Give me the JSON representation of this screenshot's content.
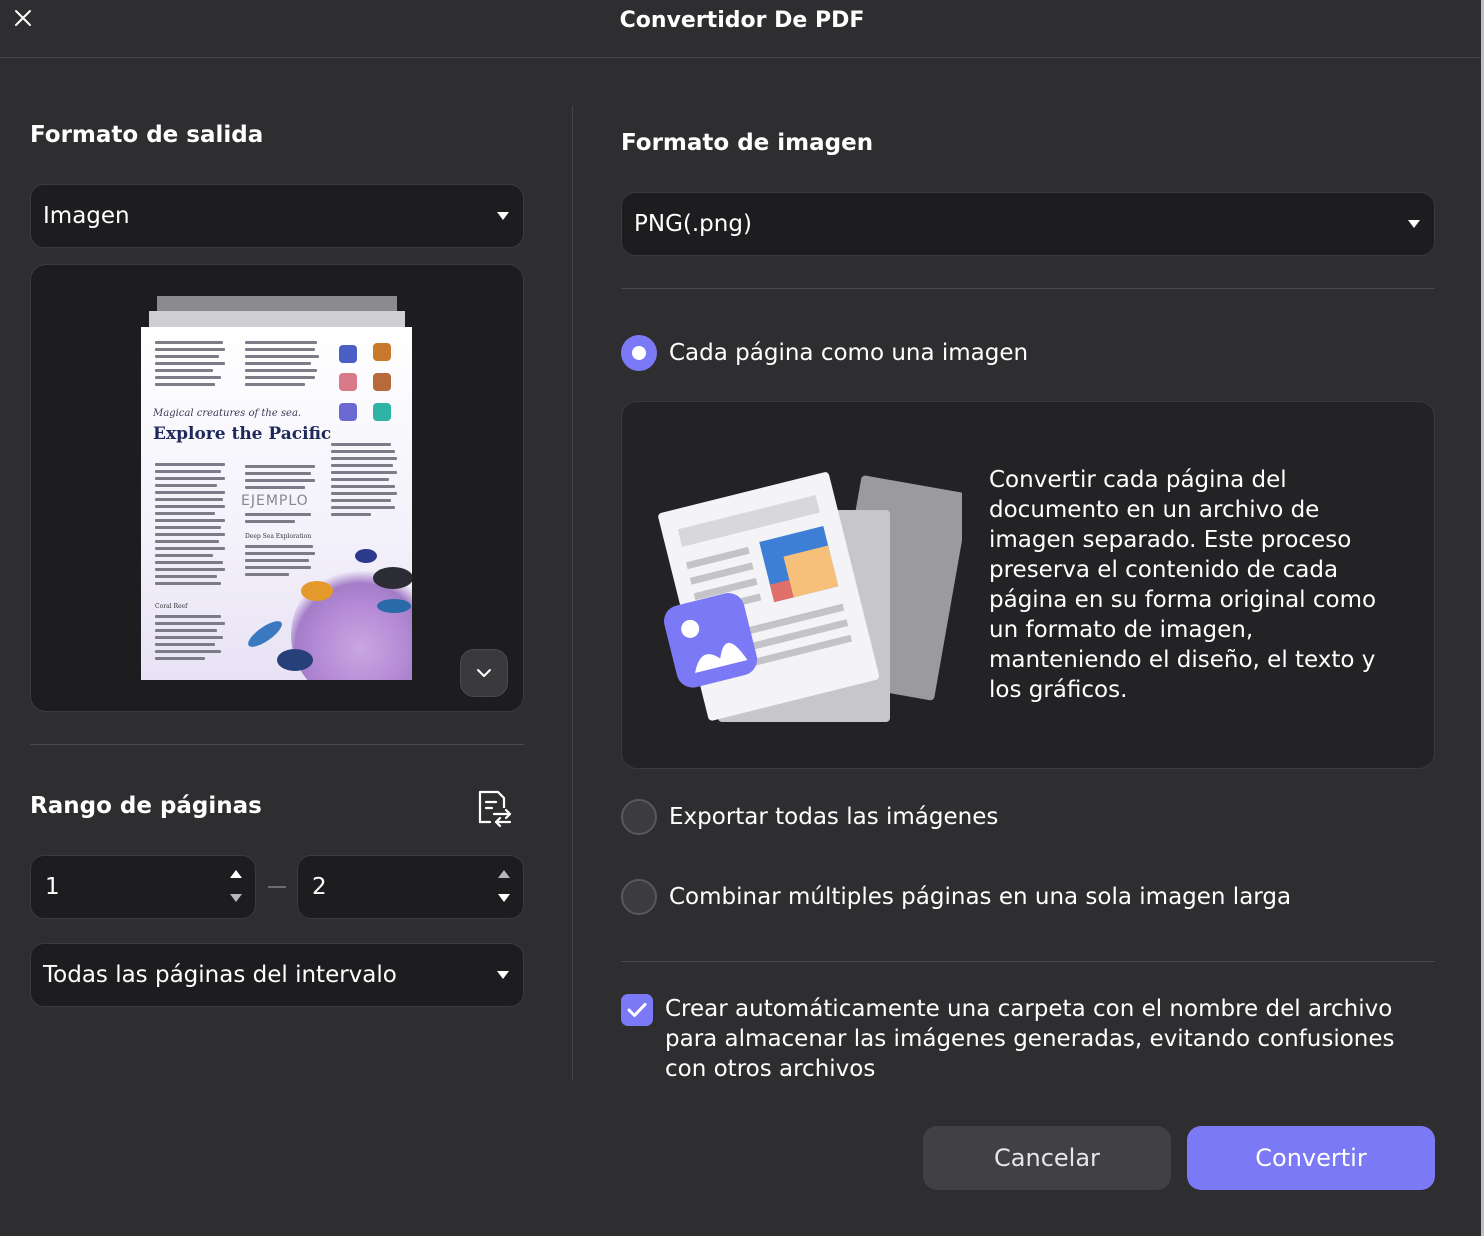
{
  "window": {
    "title": "Convertidor De PDF"
  },
  "output_format": {
    "title": "Formato de salida",
    "selected": "Imagen"
  },
  "preview": {
    "page_subtitle": "Magical creatures of the sea.",
    "page_heading": "Explore the Pacific",
    "watermark": "EJEMPLO",
    "section_a": "Deep Sea Exploration",
    "section_b": "Coral Reef"
  },
  "page_range": {
    "title": "Rango de páginas",
    "from": "1",
    "to": "2",
    "mode": "Todas las páginas del intervalo"
  },
  "image_format": {
    "title": "Formato de imagen",
    "selected": "PNG(.png)"
  },
  "options": {
    "each_page": "Cada página como una imagen",
    "export_all": "Exportar todas las imágenes",
    "combine": "Combinar múltiples páginas en una sola imagen larga",
    "selected": "each_page"
  },
  "info": {
    "description": "Convertir cada página del documento en un archivo de imagen separado. Este proceso preserva el contenido de cada página en su forma original como un formato de imagen, manteniendo el diseño, el texto y los gráficos."
  },
  "auto_folder": {
    "checked": true,
    "label": "Crear automáticamente una carpeta con el nombre del archivo para almacenar las imágenes generadas, evitando confusiones con otros archivos"
  },
  "buttons": {
    "cancel": "Cancelar",
    "convert": "Convertir"
  },
  "colors": {
    "accent": "#7b79f5",
    "background": "#2e2e30",
    "field": "#1d1d1f"
  }
}
